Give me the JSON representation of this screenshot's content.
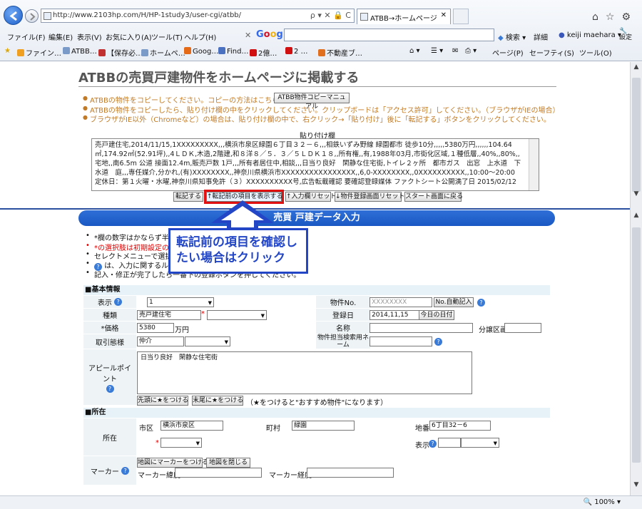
{
  "browser": {
    "url": "http://www.2103hp.com/H/HP-1study3/user-cgi/atbb/",
    "address_tools": "ρ ▾ ✕ 🔒 C",
    "tab_title": "ATBB→ホームページ",
    "menu": [
      "ファイル(F)",
      "編集(E)",
      "表示(V)",
      "お気に入り(A)",
      "ツール(T)",
      "ヘルプ(H)"
    ],
    "google": {
      "close": "✕",
      "logo": "Google",
      "search_label": "検索",
      "more_label": "詳細",
      "user": "keiji maehara",
      "settings": "設定"
    },
    "favorites": [
      "ファイン…",
      "ATBB…",
      "【保存必…",
      "ホームペ…",
      "Goog…",
      "Find…",
      "2億…",
      "2 …",
      "不動産ブ…"
    ],
    "command_right": [
      "ページ(P)",
      "セーフティ(S)",
      "ツール(O)"
    ],
    "zoom": "100%"
  },
  "page": {
    "title": "ATBBの売買戸建物件をホームページに掲載する",
    "instructions": [
      "ATBBの物件をコピーしてください。コピーの方法はこちら→",
      "ATBBの物件をコピーしたら、貼り付け欄の中をクリックしてください。クリップボードは「アクセス許可」してください。（ブラウザがIEの場合）",
      "ブラウザがIE以外（Chromeなど）の場合は、貼り付け欄の中で、右クリック→「貼り付け」後に「転記する」ボタンをクリックしてください。"
    ],
    "manual_button": "ATBB物件コピーマニュアル",
    "paste_label": "貼り付け欄",
    "paste_text": "売戸建住宅,2014/11/15,1XXXXXXXXX,,,横浜市泉区緑園６丁目３２－６,,,相鉄いずみ野線 緑園都市 徒歩10分,,,,,5380万円,,,,,,104.64㎡,174.92㎡(52.91坪),,4ＬＤＫ,木造,2階建,和８洋８／５．３／５ＬＤＫ１８,,所有権,,有,1988年03月,市街化区域,１種低層,,40%,,80%,,宅地,,南6.5m 公道 接面12.4m,販売戸数 1戸,,,所有者居住中,相談,,,日当り良好　閑静な住宅街,トイレ２ヶ所　都市ガス　出窓　上水道　下水道　庭,,,専任媒介,分かれ,(有)XXXXXXXX,,神奈川県横浜市XXXXXXXXXXXXXXXX,,6,0-XXXXXXXX,,0XXXXXXXXXX,,10:00～20:00　定休日：第１火曜・水曜,神奈川県知事免許（３）XXXXXXXXXX号,広告転載確認 要確認登録媒体 ファクトシート公開満了日 2015/02/12",
    "buttons": [
      "転記する",
      "↑転記前の項目を表示する",
      "↑入力欄リセット",
      "↓物件登録画面リセット",
      "スタート画面に戻る"
    ],
    "banner": "売買 戸建データ入力",
    "notes": [
      "*欄の数字はかならず半角で入力してください。",
      "*の選択肢は初期設定のままでかまいません。",
      "セレクトメニューで選択してください。（入力補助機能）",
      "は、入力に関するルールです。クリックしてご覧ください。",
      "記入・修正が完了したら一番下の登録ボタンを押してください。"
    ],
    "callout": "転記前の項目を確認したい場合はクリック"
  },
  "form": {
    "sec_basic": "■基本情報",
    "display_label": "表示",
    "display_value": "1",
    "bukken_no_label": "物件No.",
    "bukken_no_value": "XXXXXXXX",
    "auto_no_btn": "No.自動記入",
    "type_label": "種類",
    "type_value": "売戸建住宅",
    "reg_date_label": "登録日",
    "reg_date_value": "2014,11,15",
    "today_btn": "今日の日付",
    "price_label": "*価格",
    "price_value": "5380",
    "price_unit": "万円",
    "name_label": "名称",
    "lot_label": "分譲区画",
    "deal_label": "取引態様",
    "deal_value": "仲介",
    "staff_label": "物件担当検索用ネーム",
    "appeal_label": "アピールポイント",
    "appeal_value": "日当り良好　閑静な住宅街",
    "star_front_btn": "先頭に★をつける",
    "star_end_btn": "末尾に★をつける",
    "star_note": "（★をつけると\"おすすめ物件\"になります）",
    "sec_location": "■所在",
    "location_label": "所在",
    "city_label": "市区",
    "city_value": "横浜市泉区",
    "town_label": "町村",
    "town_value": "緑園",
    "chiban_label": "地番",
    "chiban_value": "6丁目32－6",
    "display2_label": "表示",
    "marker_label": "マーカー",
    "marker_btn": "地図にマーカーをつける",
    "close_map_btn": "地図を閉じる",
    "lat_label": "マーカー緯度",
    "lng_label": "マーカー経度"
  }
}
